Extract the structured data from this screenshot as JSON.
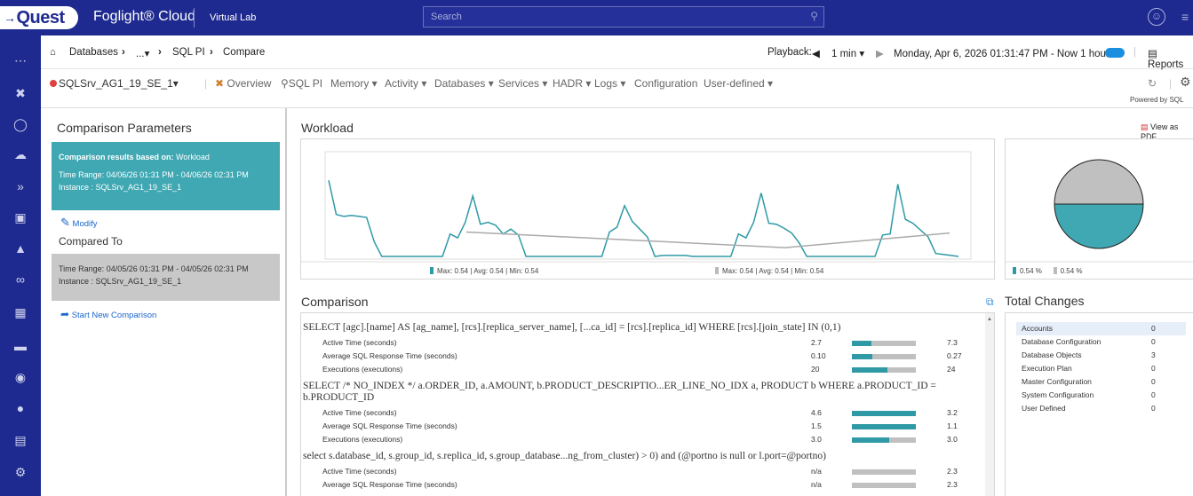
{
  "app": {
    "logo": "Quest",
    "brand": "Foglight® Cloud",
    "env": "Virtual Lab"
  },
  "search": {
    "placeholder": "Search"
  },
  "breadcrumb": {
    "home_label": "Databases",
    "ellipsis": "...",
    "sqlpi": "SQL PI",
    "current": "Compare"
  },
  "playback": {
    "label": "Playback:",
    "interval": "1 min",
    "datetime": "Monday, Apr 6, 2026 01:31:47 PM - Now 1 hour",
    "reports": "Reports"
  },
  "nav": {
    "instance": "SQLSrv_AG1_19_SE_1",
    "items": [
      "Overview",
      "SQL PI",
      "Memory",
      "Activity",
      "Databases",
      "Services",
      "HADR",
      "Logs",
      "Configuration",
      "User-defined"
    ],
    "powered_by": "Powered by SQL"
  },
  "params": {
    "title": "Comparison Parameters",
    "based_on_label": "Comparison results based on:",
    "based_on_value": "Workload",
    "time_range_1": "Time Range: 04/06/26 01:31 PM - 04/06/26 02:31 PM",
    "instance_1": "Instance : SQLSrv_AG1_19_SE_1",
    "modify": "Modify",
    "compared_to": "Compared To",
    "time_range_2": "Time Range: 04/05/26 01:31 PM - 04/05/26 02:31 PM",
    "instance_2": "Instance : SQLSrv_AG1_19_SE_1",
    "start_new": "Start New Comparison"
  },
  "workload": {
    "title": "Workload",
    "view_pdf": "View as PDF",
    "legend1": "Max: 0.54 | Avg: 0.54 | Min: 0.54",
    "legend2": "Max: 0.54 | Avg: 0.54 | Min: 0.54",
    "pie_legend1": "0.54 %",
    "pie_legend2": "0.54 %"
  },
  "chart_data": {
    "type": "line",
    "series": [
      {
        "values": [
          0.78,
          0.43,
          0.41,
          0.42,
          0.41,
          0.4,
          0.15,
          0.0,
          0.0,
          0.0,
          0.0,
          0.0,
          0.0,
          0.0,
          0.0,
          0.0,
          0.23,
          0.19,
          0.35,
          0.62,
          0.33,
          0.35,
          0.32,
          0.23,
          0.28,
          0.22,
          0.0,
          0.0,
          0.0,
          0.0,
          0.0,
          0.0,
          0.0,
          0.0,
          0.0,
          0.0,
          0.0,
          0.25,
          0.3,
          0.52,
          0.36,
          0.28,
          0.2,
          0.0,
          0.01,
          0.01,
          0.01,
          0.01,
          0.0,
          0.0,
          0.0,
          0.0,
          0.0,
          0.0,
          0.23,
          0.19,
          0.35,
          0.65,
          0.34,
          0.33,
          0.29,
          0.24,
          0.14,
          0.0,
          0.0,
          0.0,
          0.0,
          0.0,
          0.0,
          0.0,
          0.0,
          0.0,
          0.0,
          0.22,
          0.23,
          0.74,
          0.38,
          0.34,
          0.27,
          0.2,
          0.03,
          0.02,
          0.01,
          0.0
        ]
      },
      {
        "values": [
          0.25,
          0.09,
          0.24
        ]
      }
    ]
  },
  "comparison": {
    "title": "Comparison",
    "queries": [
      {
        "sql": "SELECT [agc].[name] AS [ag_name], [rcs].[replica_server_name], [...ca_id] = [rcs].[replica_id] WHERE [rcs].[join_state] IN (0,1)",
        "rows": [
          {
            "label": "Active Time (seconds)",
            "v1": "2.7",
            "v2": "7.3",
            "pct": 0.3
          },
          {
            "label": "Average SQL Response Time (seconds)",
            "v1": "0.10",
            "v2": "0.27",
            "pct": 0.32
          },
          {
            "label": "Executions (executions)",
            "v1": "20",
            "v2": "24",
            "pct": 0.55
          }
        ]
      },
      {
        "sql": "SELECT /* NO_INDEX */ a.ORDER_ID, a.AMOUNT, b.PRODUCT_DESCRIPTIO...ER_LINE_NO_IDX a, PRODUCT b WHERE a.PRODUCT_ID = b.PRODUCT_ID",
        "rows": [
          {
            "label": "Active Time (seconds)",
            "v1": "4.6",
            "v2": "3.2",
            "pct": 1.0
          },
          {
            "label": "Average SQL Response Time (seconds)",
            "v1": "1.5",
            "v2": "1.1",
            "pct": 1.0
          },
          {
            "label": "Executions (executions)",
            "v1": "3.0",
            "v2": "3.0",
            "pct": 0.58
          }
        ]
      },
      {
        "sql": "select s.database_id, s.group_id, s.replica_id, s.group_database...ng_from_cluster) > 0) and (@portno is null or l.port=@portno)",
        "rows": [
          {
            "label": "Active Time (seconds)",
            "v1": "n/a",
            "v2": "2.3",
            "pct": 0
          },
          {
            "label": "Average SQL Response Time (seconds)",
            "v1": "n/a",
            "v2": "2.3",
            "pct": 0
          }
        ]
      }
    ]
  },
  "total_changes": {
    "title": "Total Changes",
    "rows": [
      {
        "name": "Accounts",
        "count": "0"
      },
      {
        "name": "Database Configuration",
        "count": "0"
      },
      {
        "name": "Database Objects",
        "count": "3"
      },
      {
        "name": "Execution Plan",
        "count": "0"
      },
      {
        "name": "Master Configuration",
        "count": "0"
      },
      {
        "name": "System Configuration",
        "count": "0"
      },
      {
        "name": "User Defined",
        "count": "0"
      }
    ]
  },
  "colors": {
    "primary": "#1e2a8f",
    "teal": "#3fa8b3",
    "gray": "#c8c8c8",
    "link": "#1a66cc"
  }
}
